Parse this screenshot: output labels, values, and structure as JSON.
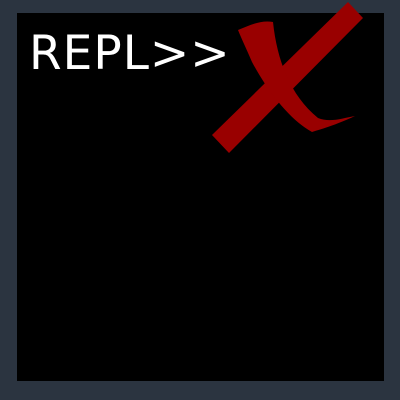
{
  "logo": {
    "text": "REPL>>",
    "mark_icon": "x-mark-icon"
  },
  "colors": {
    "frame": "#2b3440",
    "screen": "#000000",
    "text": "#ffffff",
    "mark": "#990000"
  }
}
